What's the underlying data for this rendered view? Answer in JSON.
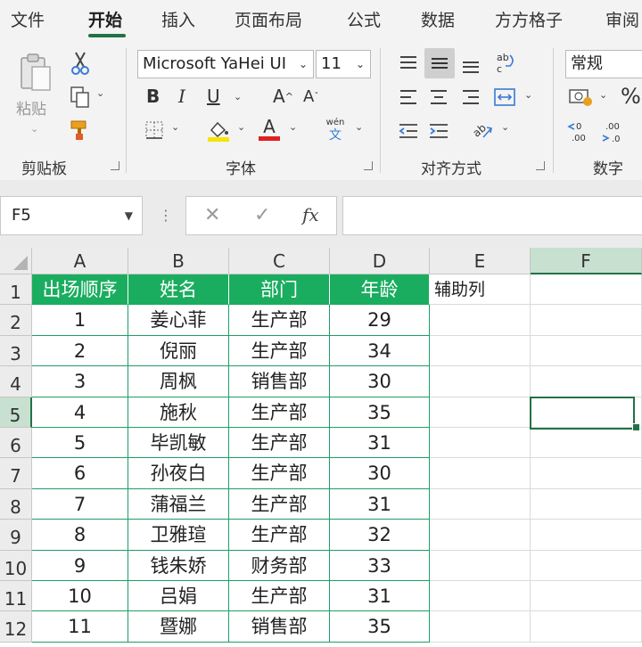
{
  "menu": {
    "tabs": [
      "文件",
      "开始",
      "插入",
      "页面布局",
      "公式",
      "数据",
      "方方格子",
      "审阅"
    ],
    "active": "开始"
  },
  "ribbon": {
    "clipboard": {
      "label": "剪贴板",
      "paste_label": "粘贴"
    },
    "font": {
      "label": "字体",
      "font_name": "Microsoft YaHei UI",
      "font_size": "11",
      "bold": "B",
      "italic": "I",
      "underline": "U",
      "grow": "A",
      "shrink": "A",
      "font_color_letter": "A",
      "phonetic_top": "wén",
      "phonetic_bottom": "文",
      "highlight_color": "#f5e500",
      "font_color": "#e02020"
    },
    "alignment": {
      "label": "对齐方式"
    },
    "number": {
      "label": "数字",
      "format": "常规",
      "percent": "%"
    }
  },
  "formula_bar": {
    "name_box": "F5",
    "dots": "⋮",
    "cancel": "✕",
    "confirm": "✓",
    "fx": "fx",
    "content": ""
  },
  "sheet": {
    "columns": [
      "A",
      "B",
      "C",
      "D",
      "E",
      "F"
    ],
    "rows": [
      "1",
      "2",
      "3",
      "4",
      "5",
      "6",
      "7",
      "8",
      "9",
      "10",
      "11",
      "12"
    ],
    "selected_cell": "F5",
    "header_color": "#1aad5f",
    "table_header": [
      "出场顺序",
      "姓名",
      "部门",
      "年龄"
    ],
    "helper_header": "辅助列",
    "records": [
      [
        "1",
        "姜心菲",
        "生产部",
        "29"
      ],
      [
        "2",
        "倪丽",
        "生产部",
        "34"
      ],
      [
        "3",
        "周枫",
        "销售部",
        "30"
      ],
      [
        "4",
        "施秋",
        "生产部",
        "35"
      ],
      [
        "5",
        "毕凯敏",
        "生产部",
        "31"
      ],
      [
        "6",
        "孙夜白",
        "生产部",
        "30"
      ],
      [
        "7",
        "蒲福兰",
        "生产部",
        "31"
      ],
      [
        "8",
        "卫雅瑄",
        "生产部",
        "32"
      ],
      [
        "9",
        "钱朱娇",
        "财务部",
        "33"
      ],
      [
        "10",
        "吕娟",
        "生产部",
        "31"
      ],
      [
        "11",
        "暨娜",
        "销售部",
        "35"
      ]
    ]
  }
}
